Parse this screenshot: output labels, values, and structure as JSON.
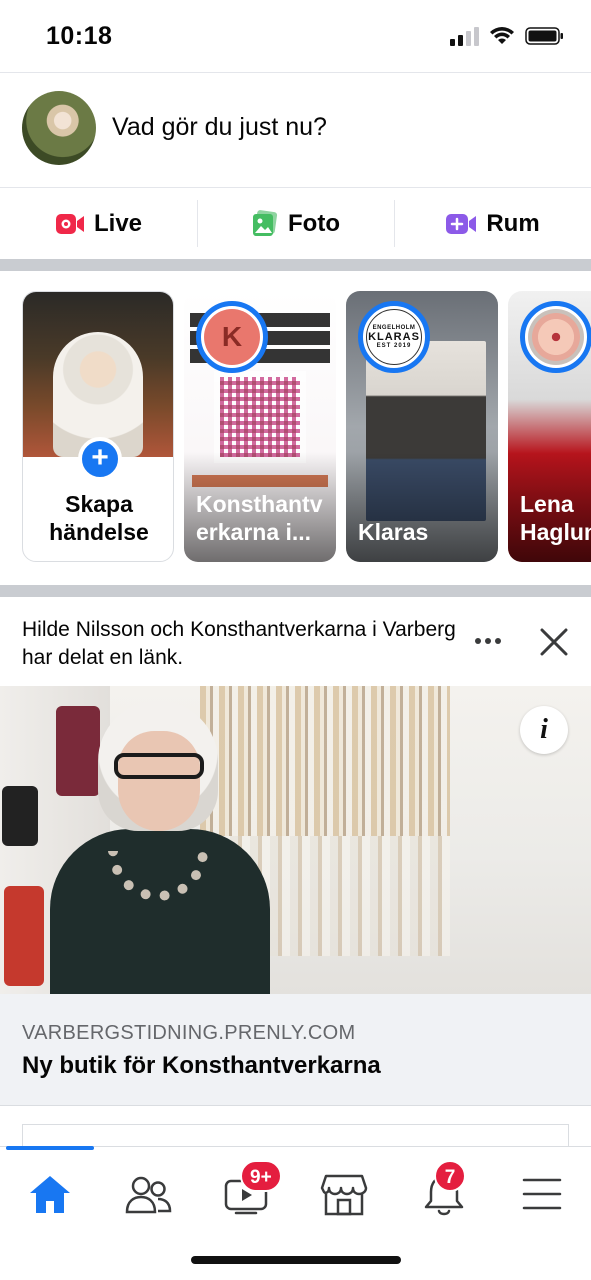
{
  "status_bar": {
    "time": "10:18",
    "icons": [
      "signal-icon",
      "wifi-icon",
      "battery-icon"
    ]
  },
  "composer": {
    "prompt": "Vad gör du just nu?"
  },
  "actions": [
    {
      "label": "Live",
      "icon": "live-video-icon",
      "color": "#f02849"
    },
    {
      "label": "Foto",
      "icon": "photo-icon",
      "color": "#45bd62"
    },
    {
      "label": "Rum",
      "icon": "room-video-icon",
      "color": "#8c5ae8"
    }
  ],
  "stories": {
    "create": {
      "line1": "Skapa",
      "line2": "händelse"
    },
    "items": [
      {
        "name": "Konsthantverkarna i...",
        "name_line1": "Konsthantv",
        "name_line2": "erkarna i...",
        "avatar_letter": "K"
      },
      {
        "name": "Klaras",
        "avatar_text": "KLARAS",
        "avatar_top": "ENGELHOLM",
        "avatar_bottom": "EST 2019"
      },
      {
        "name_line1": "Lena",
        "name_line2": "Haglun"
      }
    ]
  },
  "post": {
    "attribution": "Hilde Nilsson och Konsthantverkarna i Varberg har delat en länk.",
    "link": {
      "domain": "VARBERGSTIDNING.PRENLY.COM",
      "title": "Ny butik för Konsthantverkarna"
    }
  },
  "nav": {
    "active": "home",
    "items": [
      {
        "name": "home",
        "icon": "home-icon"
      },
      {
        "name": "friends",
        "icon": "friends-icon"
      },
      {
        "name": "watch",
        "icon": "watch-icon",
        "badge": "9+"
      },
      {
        "name": "marketplace",
        "icon": "marketplace-icon"
      },
      {
        "name": "notifications",
        "icon": "bell-icon",
        "badge": "7"
      },
      {
        "name": "menu",
        "icon": "menu-icon"
      }
    ]
  },
  "colors": {
    "accent": "#1877f2",
    "badge": "#e41e3f",
    "divider": "#c9ccd1"
  }
}
